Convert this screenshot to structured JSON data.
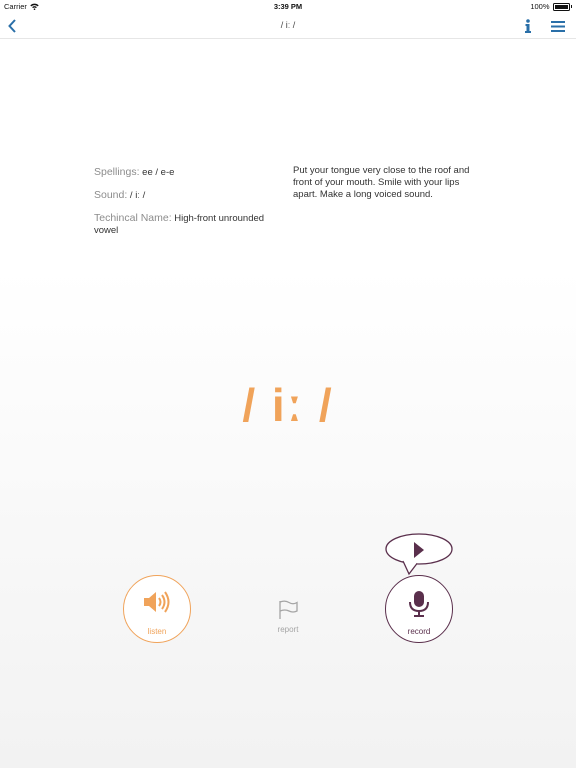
{
  "status_bar": {
    "carrier": "Carrier",
    "time": "3:39 PM",
    "battery": "100%"
  },
  "nav": {
    "title": "/ iː /",
    "back_icon": "chevron-left-icon",
    "info_icon": "info-icon",
    "menu_icon": "hamburger-menu-icon",
    "accent": "#2a6fa8"
  },
  "sound_info": {
    "spellings_label": "Spellings:",
    "spellings_value": "ee / e-e",
    "sound_label": "Sound:",
    "sound_value": "/ iː /",
    "technical_label": "Techincal Name:",
    "technical_value": "High-front unrounded vowel",
    "instructions": "Put your tongue very close to the roof and front of your mouth. Smile with your lips apart. Make a long voiced sound."
  },
  "phoneme_display": "/ iː /",
  "actions": {
    "listen": {
      "label": "listen",
      "icon": "speaker-icon",
      "color": "#f0a35a"
    },
    "report": {
      "label": "report",
      "icon": "flag-icon",
      "color": "#a5a5a5"
    },
    "record": {
      "label": "record",
      "icon": "microphone-icon",
      "color": "#5a2f4c"
    },
    "playback": {
      "icon": "play-icon"
    }
  }
}
